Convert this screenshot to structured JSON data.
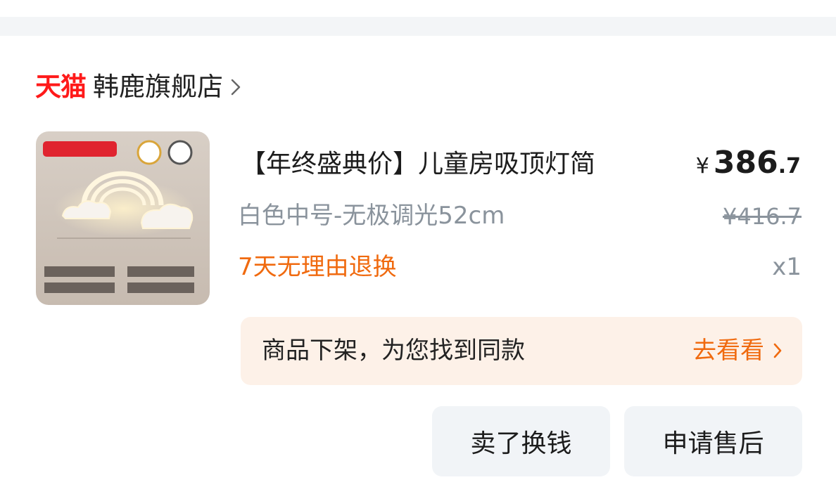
{
  "store": {
    "logo_text": "天猫",
    "name": "韩鹿旗舰店",
    "chevron_icon": "chevron-right-icon"
  },
  "product": {
    "image_badge": "白色中号-无极调光",
    "title": "【年终盛典价】儿童房吸顶灯简",
    "price": {
      "currency": "¥",
      "integer": "386",
      "decimal": ".7"
    },
    "variant": "白色中号-无极调光52cm",
    "original_price": "¥416.7",
    "return_policy": "7天无理由退换",
    "quantity": "x1"
  },
  "notice": {
    "text": "商品下架，为您找到同款",
    "link_label": "去看看",
    "link_icon": "chevron-right-icon"
  },
  "actions": {
    "sell_label": "卖了换钱",
    "aftersale_label": "申请售后"
  },
  "colors": {
    "tmall_red": "#ff1a1a",
    "accent_orange": "#f06a0f",
    "muted_text": "#8a939c",
    "notice_bg": "#fdf1e8",
    "button_bg": "#f1f4f7"
  }
}
